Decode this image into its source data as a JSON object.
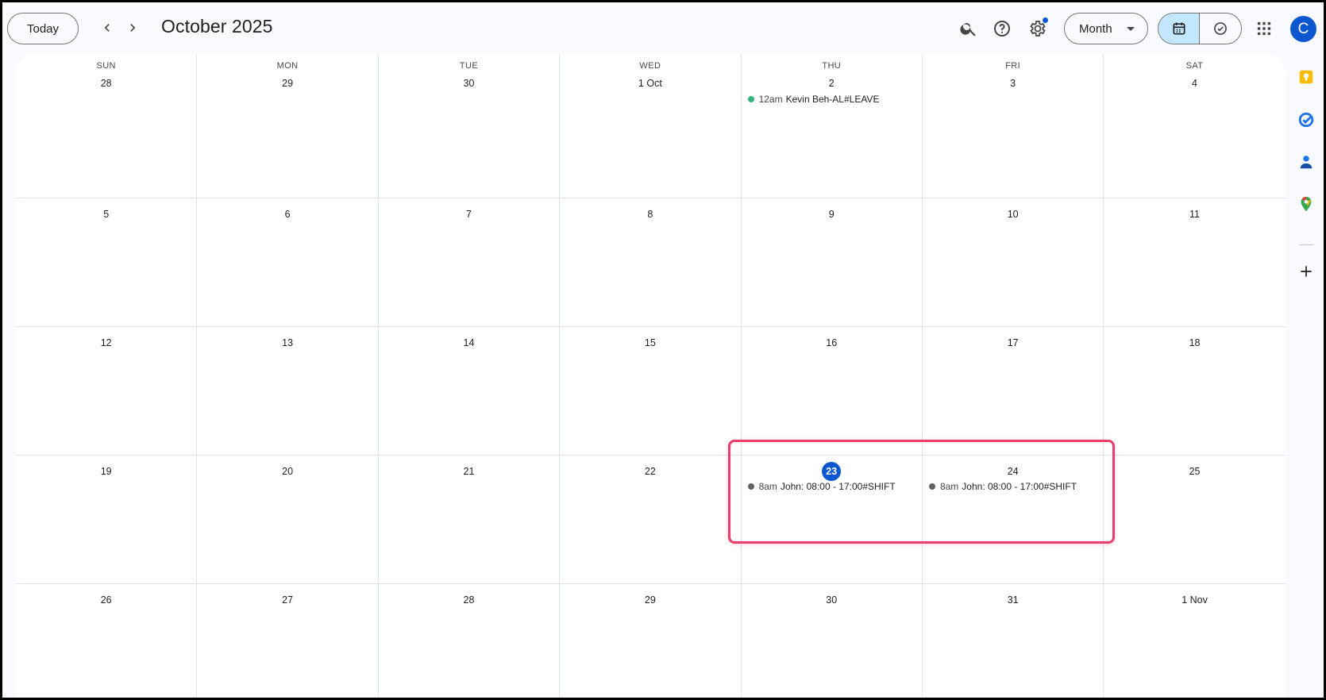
{
  "header": {
    "today_label": "Today",
    "title": "October 2025",
    "view_select": "Month",
    "avatar_letter": "C"
  },
  "weekdays": [
    "SUN",
    "MON",
    "TUE",
    "WED",
    "THU",
    "FRI",
    "SAT"
  ],
  "weeks": [
    [
      {
        "label": "28"
      },
      {
        "label": "29"
      },
      {
        "label": "30"
      },
      {
        "label": "1 Oct"
      },
      {
        "label": "2",
        "events": [
          {
            "time": "12am",
            "title": "Kevin Beh-AL#LEAVE",
            "color": "#33b679"
          }
        ]
      },
      {
        "label": "3"
      },
      {
        "label": "4"
      }
    ],
    [
      {
        "label": "5"
      },
      {
        "label": "6"
      },
      {
        "label": "7"
      },
      {
        "label": "8"
      },
      {
        "label": "9"
      },
      {
        "label": "10"
      },
      {
        "label": "11"
      }
    ],
    [
      {
        "label": "12"
      },
      {
        "label": "13"
      },
      {
        "label": "14"
      },
      {
        "label": "15"
      },
      {
        "label": "16"
      },
      {
        "label": "17"
      },
      {
        "label": "18"
      }
    ],
    [
      {
        "label": "19"
      },
      {
        "label": "20"
      },
      {
        "label": "21"
      },
      {
        "label": "22"
      },
      {
        "label": "23",
        "today": true,
        "events": [
          {
            "time": "8am",
            "title": "John: 08:00 - 17:00#SHIFT",
            "color": "#616161"
          }
        ]
      },
      {
        "label": "24",
        "events": [
          {
            "time": "8am",
            "title": "John: 08:00 - 17:00#SHIFT",
            "color": "#616161"
          }
        ]
      },
      {
        "label": "25"
      }
    ],
    [
      {
        "label": "26"
      },
      {
        "label": "27"
      },
      {
        "label": "28"
      },
      {
        "label": "29"
      },
      {
        "label": "30"
      },
      {
        "label": "31"
      },
      {
        "label": "1 Nov"
      }
    ]
  ],
  "icons": {
    "search": "search-icon",
    "help": "help-icon",
    "settings": "gear-icon",
    "apps": "apps-grid-icon",
    "calendar_view": "calendar-icon",
    "tasks_view": "task-check-icon",
    "keep": "keep-icon",
    "tasks": "tasks-icon",
    "contacts": "contacts-icon",
    "maps": "maps-icon",
    "add": "plus-icon"
  },
  "colors": {
    "accent": "#0b57d0",
    "highlight": "#ea3f6e",
    "leave_event": "#33b679",
    "shift_event": "#616161"
  }
}
